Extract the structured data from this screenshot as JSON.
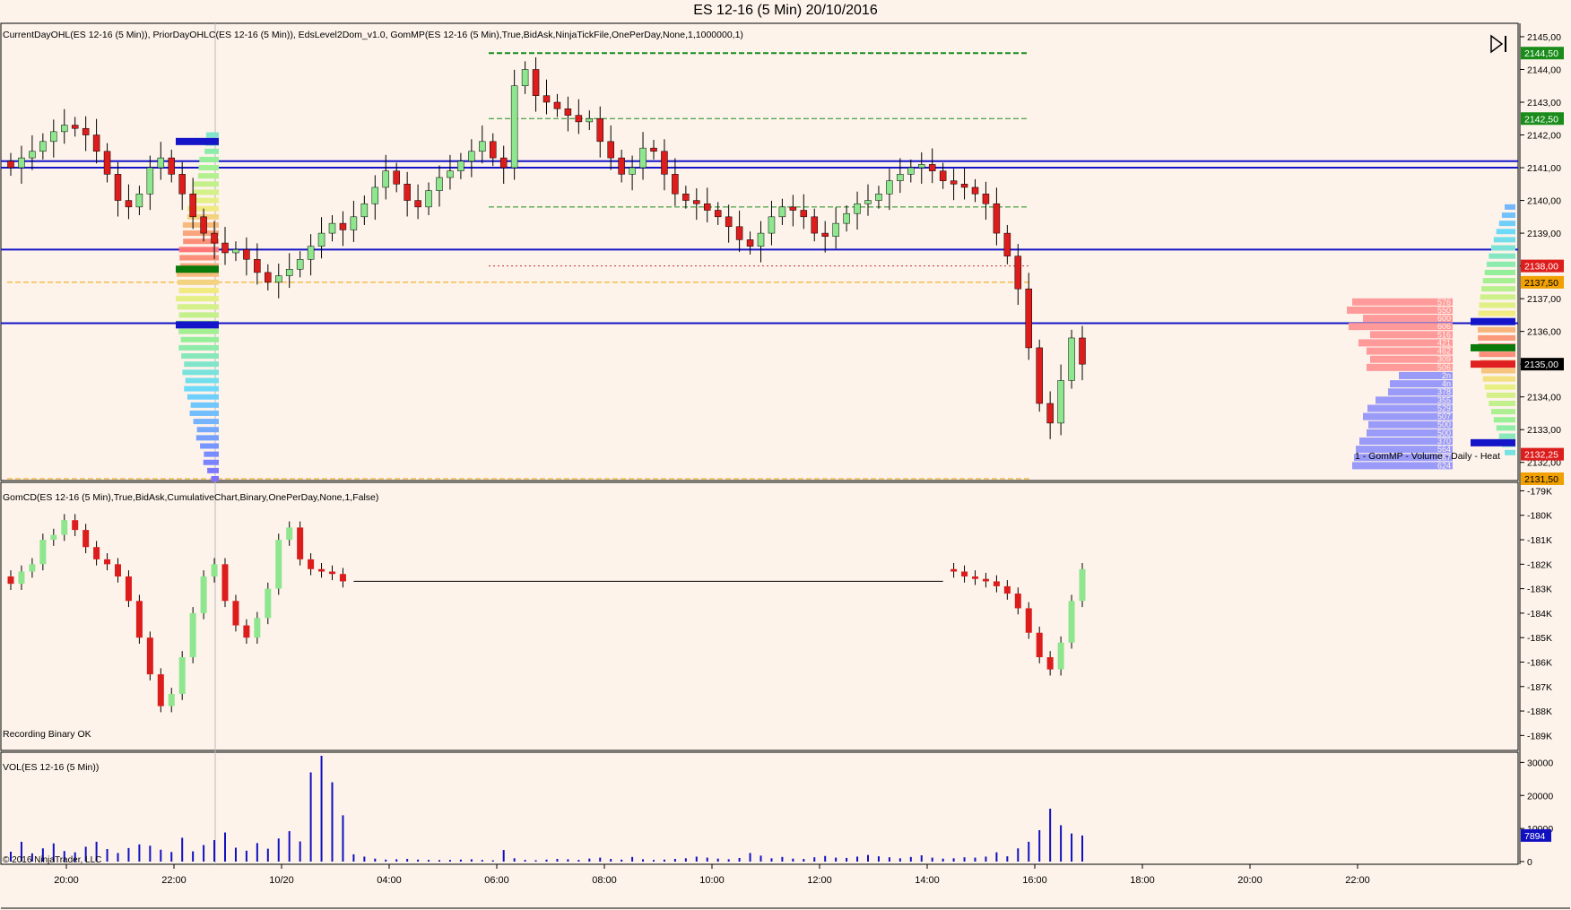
{
  "window": {
    "title": "ES 12-16 (5 Min)  20/10/2016",
    "copyright": "© 2016 NinjaTrader, LLC"
  },
  "colors": {
    "background": "#fdf3ea",
    "bull": "#8ee68e",
    "bear": "#dd1c1c",
    "level": "#1414c8",
    "green_dash": "#1a8c1a",
    "orange_dash": "#f0a000",
    "volume": "#1010c0"
  },
  "icons": {
    "nav": "skip-to-end-icon"
  },
  "panels": {
    "price": {
      "indicator_label": "CurrentDayOHL(ES 12-16 (5 Min)), PriorDayOHLC(ES 12-16 (5 Min)), EdsLevel2Dom_v1.0, GomMP(ES 12-16 (5 Min),True,BidAsk,NinjaTickFile,OnePerDay,None,1,1000000,1)",
      "profile_caption": "1 - GomMP - Volume - Daily - Heat",
      "profile_values": [
        "576",
        "550",
        "600",
        "606",
        "516",
        "421",
        "462",
        "309",
        "506",
        "2n",
        "4n",
        "378",
        "355",
        "529",
        "507",
        "500",
        "500",
        "370",
        "564",
        "587",
        "624"
      ]
    },
    "cd": {
      "indicator_label": "GomCD(ES 12-16 (5 Min),True,BidAsk,CumulativeChart,Binary,OnePerDay,None,1,False)",
      "status": "Recording Binary OK"
    },
    "vol": {
      "indicator_label": "VOL(ES 12-16 (5 Min))"
    }
  },
  "chart_data": [
    {
      "type": "candlestick",
      "title": "ES 12-16 (5 Min)  20/10/2016",
      "ylim": [
        2131.5,
        2145.3
      ],
      "y_ticks": [
        "2145,00",
        "2144,00",
        "2143,00",
        "2142,00",
        "2141,00",
        "2140,00",
        "2139,00",
        "2138,00",
        "2137,00",
        "2136,00",
        "2135,00",
        "2134,00",
        "2133,00",
        "2132,00"
      ],
      "x_ticks": [
        "20:00",
        "22:00",
        "10/20",
        "04:00",
        "06:00",
        "08:00",
        "10:00",
        "12:00",
        "14:00",
        "16:00",
        "18:00",
        "20:00",
        "22:00"
      ],
      "price_badges": [
        {
          "label": "2144,50",
          "value": 2144.5,
          "color": "#1a8c1a"
        },
        {
          "label": "2142,50",
          "value": 2142.5,
          "color": "#1a8c1a"
        },
        {
          "label": "2138,00",
          "value": 2138.0,
          "color": "#dd1c1c"
        },
        {
          "label": "2137,50",
          "value": 2137.5,
          "color": "#f0a000"
        },
        {
          "label": "2135,00",
          "value": 2135.0,
          "color": "#000000"
        },
        {
          "label": "2132,25",
          "value": 2132.25,
          "color": "#dd1c1c"
        },
        {
          "label": "2131,50",
          "value": 2131.5,
          "color": "#f0a000"
        }
      ],
      "horizontal_levels": [
        2141.2,
        2141.0,
        2138.5,
        2136.25
      ],
      "dashed_levels": [
        {
          "value": 2144.5,
          "color": "green"
        },
        {
          "value": 2142.5,
          "color": "green"
        },
        {
          "value": 2139.8,
          "color": "green"
        },
        {
          "value": 2138.0,
          "color": "red"
        },
        {
          "value": 2137.5,
          "color": "orange"
        },
        {
          "value": 2131.5,
          "color": "orange"
        }
      ],
      "price_series": [
        2141.0,
        2141.3,
        2141.5,
        2141.8,
        2142.1,
        2142.3,
        2142.2,
        2142.0,
        2141.5,
        2140.8,
        2140.0,
        2139.8,
        2140.2,
        2141.0,
        2141.3,
        2140.8,
        2140.2,
        2139.5,
        2139.0,
        2138.7,
        2138.4,
        2138.5,
        2138.2,
        2137.8,
        2137.5,
        2137.7,
        2137.9,
        2138.2,
        2138.6,
        2139.0,
        2139.3,
        2139.1,
        2139.5,
        2139.9,
        2140.4,
        2140.9,
        2140.5,
        2140.0,
        2139.8,
        2140.3,
        2140.7,
        2140.9,
        2141.2,
        2141.5,
        2141.8,
        2141.3,
        2141.0,
        2143.5,
        2144.0,
        2143.2,
        2143.0,
        2142.8,
        2142.6,
        2142.4,
        2142.5,
        2141.8,
        2141.3,
        2140.8,
        2141.0,
        2141.6,
        2141.5,
        2140.8,
        2140.2,
        2140.0,
        2139.9,
        2139.7,
        2139.5,
        2139.2,
        2138.8,
        2138.6,
        2139.0,
        2139.5,
        2139.8,
        2139.7,
        2139.5,
        2139.0,
        2138.9,
        2139.3,
        2139.6,
        2139.9,
        2140.0,
        2140.2,
        2140.6,
        2140.8,
        2141.0,
        2141.1,
        2140.9,
        2140.6,
        2140.5,
        2140.4,
        2140.2,
        2139.9,
        2139.0,
        2138.3,
        2137.3,
        2135.5,
        2133.8,
        2133.2,
        2134.5,
        2135.8,
        2135.0
      ],
      "profile_left_session": {
        "price_top": 2142.2,
        "price_bottom": 2131.5
      },
      "profile_right_session": {
        "price_top": 2139.8,
        "price_bottom": 2132.3
      }
    },
    {
      "type": "candlestick",
      "title": "GomCD(ES 12-16 (5 Min),True,BidAsk,CumulativeChart,Binary,OnePerDay,None,1,False)",
      "ylim": [
        -189500,
        -178800
      ],
      "y_ticks": [
        "-179K",
        "-180K",
        "-181K",
        "-182K",
        "-183K",
        "-184K",
        "-185K",
        "-186K",
        "-187K",
        "-188K",
        "-189K"
      ],
      "cd_series": [
        -182800,
        -182300,
        -182000,
        -181000,
        -180800,
        -180200,
        -180600,
        -181300,
        -181800,
        -182000,
        -182500,
        -183500,
        -185000,
        -186500,
        -187800,
        -187300,
        -185800,
        -184000,
        -182500,
        -182000,
        -183500,
        -184500,
        -185000,
        -184200,
        -183000,
        -181000,
        -180500,
        -181800,
        -182200,
        -182300,
        -182400,
        -182700,
        -182700,
        -182600,
        -182600,
        -182500,
        -182400,
        -182300,
        -182200,
        -182000,
        -181900,
        -182000,
        -182200,
        -182200,
        -182200,
        -182200,
        -182200,
        -182200,
        -182200,
        -182200,
        -182200,
        -182200,
        -182200,
        -182200,
        -182200,
        -182200,
        -182200,
        -182200,
        -182200,
        -182200,
        -182200,
        -182200,
        -182200,
        -182200,
        -182200,
        -182200,
        -182200,
        -182200,
        -182200,
        -182200,
        -182200,
        -182200,
        -182200,
        -182200,
        -182200,
        -182200,
        -182200,
        -182200,
        -182200,
        -182200,
        -182200,
        -182200,
        -182200,
        -182200,
        -182200,
        -182200,
        -182200,
        -182200,
        -182300,
        -182500,
        -182600,
        -182700,
        -182900,
        -183200,
        -183800,
        -184800,
        -185800,
        -186300,
        -185200,
        -183500,
        -182200
      ]
    },
    {
      "type": "bar",
      "title": "VOL(ES 12-16 (5 Min))",
      "ylim": [
        0,
        32000
      ],
      "y_ticks": [
        "30000",
        "20000",
        "10000",
        "0"
      ],
      "last_value_badge": "7894",
      "volume_series": [
        3000,
        6000,
        2500,
        4000,
        5500,
        3200,
        2800,
        4500,
        6000,
        3800,
        2600,
        4100,
        5200,
        4800,
        3600,
        2900,
        7200,
        3100,
        5000,
        6500,
        8800,
        4200,
        3300,
        5600,
        3900,
        7000,
        9200,
        6100,
        27000,
        32000,
        24000,
        14000,
        2200,
        1500,
        900,
        600,
        700,
        800,
        600,
        500,
        450,
        500,
        600,
        700,
        500,
        400,
        3500,
        1000,
        500,
        400,
        600,
        800,
        700,
        500,
        900,
        1200,
        800,
        600,
        1400,
        700,
        500,
        600,
        800,
        1000,
        1500,
        1200,
        900,
        700,
        1100,
        2600,
        1800,
        1000,
        1400,
        900,
        800,
        1300,
        1700,
        1200,
        1100,
        1500,
        2000,
        1600,
        1300,
        1000,
        1400,
        1900,
        1200,
        900,
        1000,
        1300,
        1200,
        1500,
        2800,
        1600,
        4000,
        6000,
        9500,
        16000,
        11000,
        8500,
        7894
      ]
    }
  ]
}
